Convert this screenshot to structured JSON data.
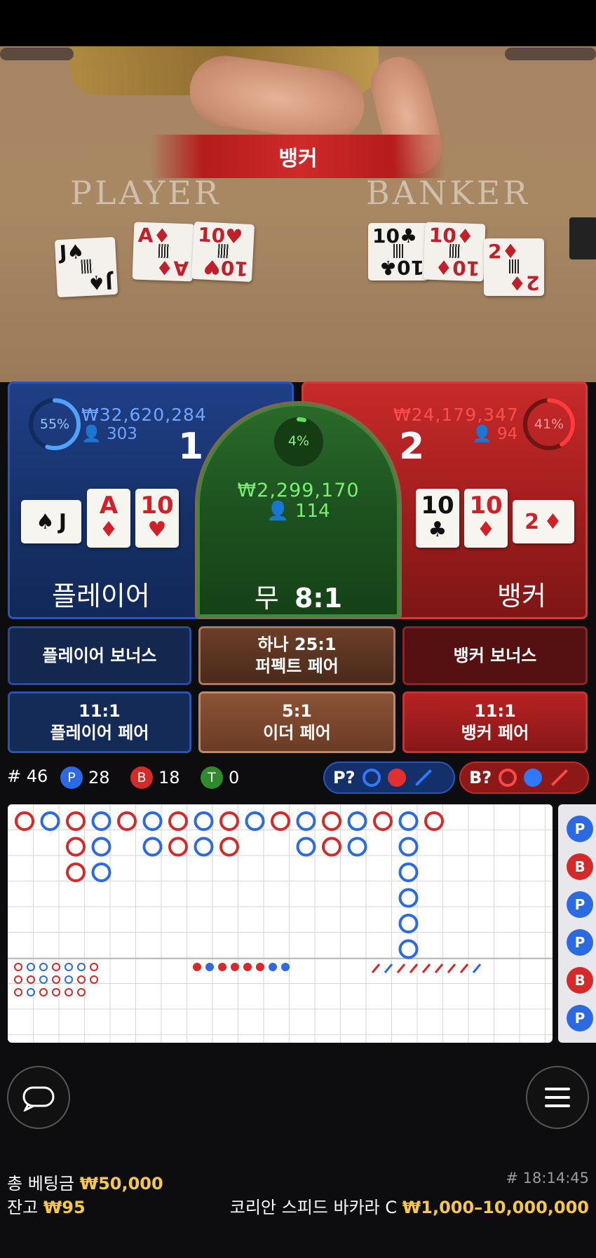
{
  "video": {
    "banner": "뱅커",
    "player_word": "PLAYER",
    "banker_word": "BANKER",
    "player_cards": [
      {
        "rank": "J",
        "suit": "♠",
        "color": "black"
      },
      {
        "rank": "A",
        "suit": "♦",
        "color": "red"
      },
      {
        "rank": "10",
        "suit": "♥",
        "color": "red"
      }
    ],
    "banker_cards": [
      {
        "rank": "10",
        "suit": "♣",
        "color": "black"
      },
      {
        "rank": "10",
        "suit": "♦",
        "color": "red"
      },
      {
        "rank": "2",
        "suit": "♦",
        "color": "red"
      }
    ]
  },
  "player": {
    "percent": "55%",
    "percent_value": 55,
    "amount": "₩32,620,284",
    "count": "303",
    "score": "1",
    "label": "플레이어",
    "cards": [
      {
        "rank": "J",
        "suit": "♠",
        "color": "black"
      },
      {
        "rank": "A",
        "suit": "♦",
        "color": "red"
      },
      {
        "rank": "10",
        "suit": "♥",
        "color": "red"
      }
    ]
  },
  "tie": {
    "percent": "4%",
    "percent_value": 4,
    "amount": "₩2,299,170",
    "count": "114",
    "label": "무",
    "odds": "8:1"
  },
  "banker": {
    "percent": "41%",
    "percent_value": 41,
    "amount": "₩24,179,347",
    "count": "94",
    "score": "2",
    "label": "뱅커",
    "cards": [
      {
        "rank": "10",
        "suit": "♣",
        "color": "black"
      },
      {
        "rank": "10",
        "suit": "♦",
        "color": "red"
      },
      {
        "rank": "2",
        "suit": "♦",
        "color": "red"
      }
    ]
  },
  "side_bets": {
    "player_bonus": "플레이어 보너스",
    "perfect_pair_line1": "하나 25:1",
    "perfect_pair_line2": "퍼펙트 페어",
    "banker_bonus": "뱅커 보너스",
    "player_pair_odds": "11:1",
    "player_pair": "플레이어 페어",
    "either_pair_odds": "5:1",
    "either_pair": "이더 페어",
    "banker_pair_odds": "11:1",
    "banker_pair": "뱅커 페어"
  },
  "stats": {
    "round": "# 46",
    "p_letter": "P",
    "p_count": "28",
    "b_letter": "B",
    "b_count": "18",
    "t_letter": "T",
    "t_count": "0",
    "p_predict": "P?",
    "b_predict": "B?"
  },
  "roadmap": {
    "big_road": [
      [
        "B"
      ],
      [
        "P"
      ],
      [
        "B",
        "B",
        "B"
      ],
      [
        "P",
        "P",
        "P"
      ],
      [
        "B"
      ],
      [
        "P",
        "P"
      ],
      [
        "B",
        "B"
      ],
      [
        "P",
        "P"
      ],
      [
        "B",
        "B"
      ],
      [
        "P"
      ],
      [
        "B"
      ],
      [
        "P",
        "P"
      ],
      [
        "B",
        "B"
      ],
      [
        "P",
        "P"
      ],
      [
        "B"
      ],
      [
        "P",
        "P",
        "P",
        "P",
        "P",
        "P"
      ],
      [
        "B"
      ]
    ],
    "side_road": [
      "P",
      "B",
      "P",
      "P",
      "B",
      "P"
    ]
  },
  "footer": {
    "total_bet_label": "총 베팅금",
    "total_bet": "₩50,000",
    "balance_label": "잔고",
    "balance": "₩95",
    "time": "# 18:14:45",
    "table_name": "코리안 스피드 바카라 C",
    "limits": "₩1,000–10,000,000"
  },
  "colors": {
    "player_blue": "#2b6ae0",
    "banker_red": "#d42a2a",
    "tie_green": "#2f8a2c",
    "gold": "#f5c84a"
  }
}
